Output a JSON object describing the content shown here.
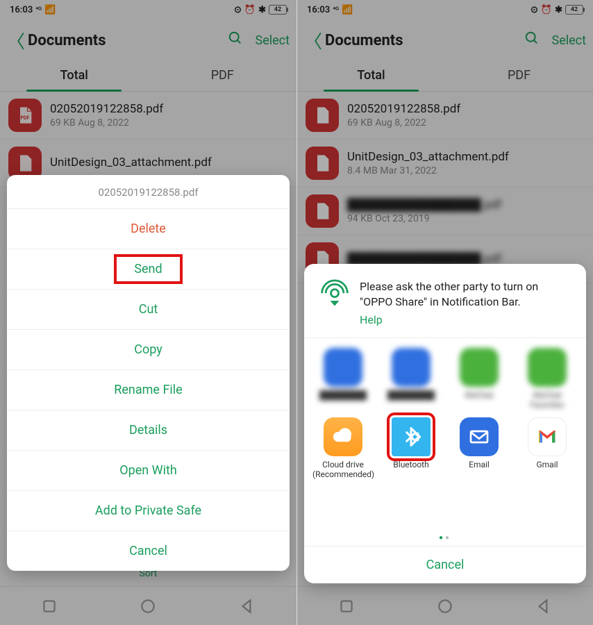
{
  "status": {
    "time": "16:03",
    "battery": "42"
  },
  "header": {
    "title": "Documents",
    "select": "Select"
  },
  "tabs": {
    "total": "Total",
    "pdf": "PDF"
  },
  "left": {
    "files": [
      {
        "name": "02052019122858.pdf",
        "meta": "69 KB   Aug 8, 2022"
      },
      {
        "name": "UnitDesign_03_attachment.pdf",
        "meta": ""
      }
    ],
    "menu_title": "02052019122858.pdf",
    "menu": {
      "delete": "Delete",
      "send": "Send",
      "cut": "Cut",
      "copy": "Copy",
      "rename": "Rename File",
      "details": "Details",
      "openwith": "Open With",
      "privatesafe": "Add to Private Safe",
      "cancel": "Cancel"
    }
  },
  "right": {
    "files": [
      {
        "name": "02052019122858.pdf",
        "meta": "69 KB   Aug 8, 2022"
      },
      {
        "name": "UnitDesign_03_attachment.pdf",
        "meta": "8.4 MB   Mar 31, 2022"
      },
      {
        "name": "████████████████.pdf",
        "meta": "94 KB   Oct 23, 2019"
      },
      {
        "name": "████████████████.pdf",
        "meta": ""
      }
    ],
    "share_message": "Please ask the other party to turn on \"OPPO Share\" in Notification Bar.",
    "help": "Help",
    "apps_row1": [
      {
        "label": "████████"
      },
      {
        "label": "████████"
      },
      {
        "label": "WeChat"
      },
      {
        "label": "WeChat Favorites"
      }
    ],
    "apps_row2": [
      {
        "label": "Cloud drive (Recommended)"
      },
      {
        "label": "Bluetooth"
      },
      {
        "label": "Email"
      },
      {
        "label": "Gmail"
      }
    ],
    "cancel": "Cancel"
  },
  "sort": "Sort"
}
